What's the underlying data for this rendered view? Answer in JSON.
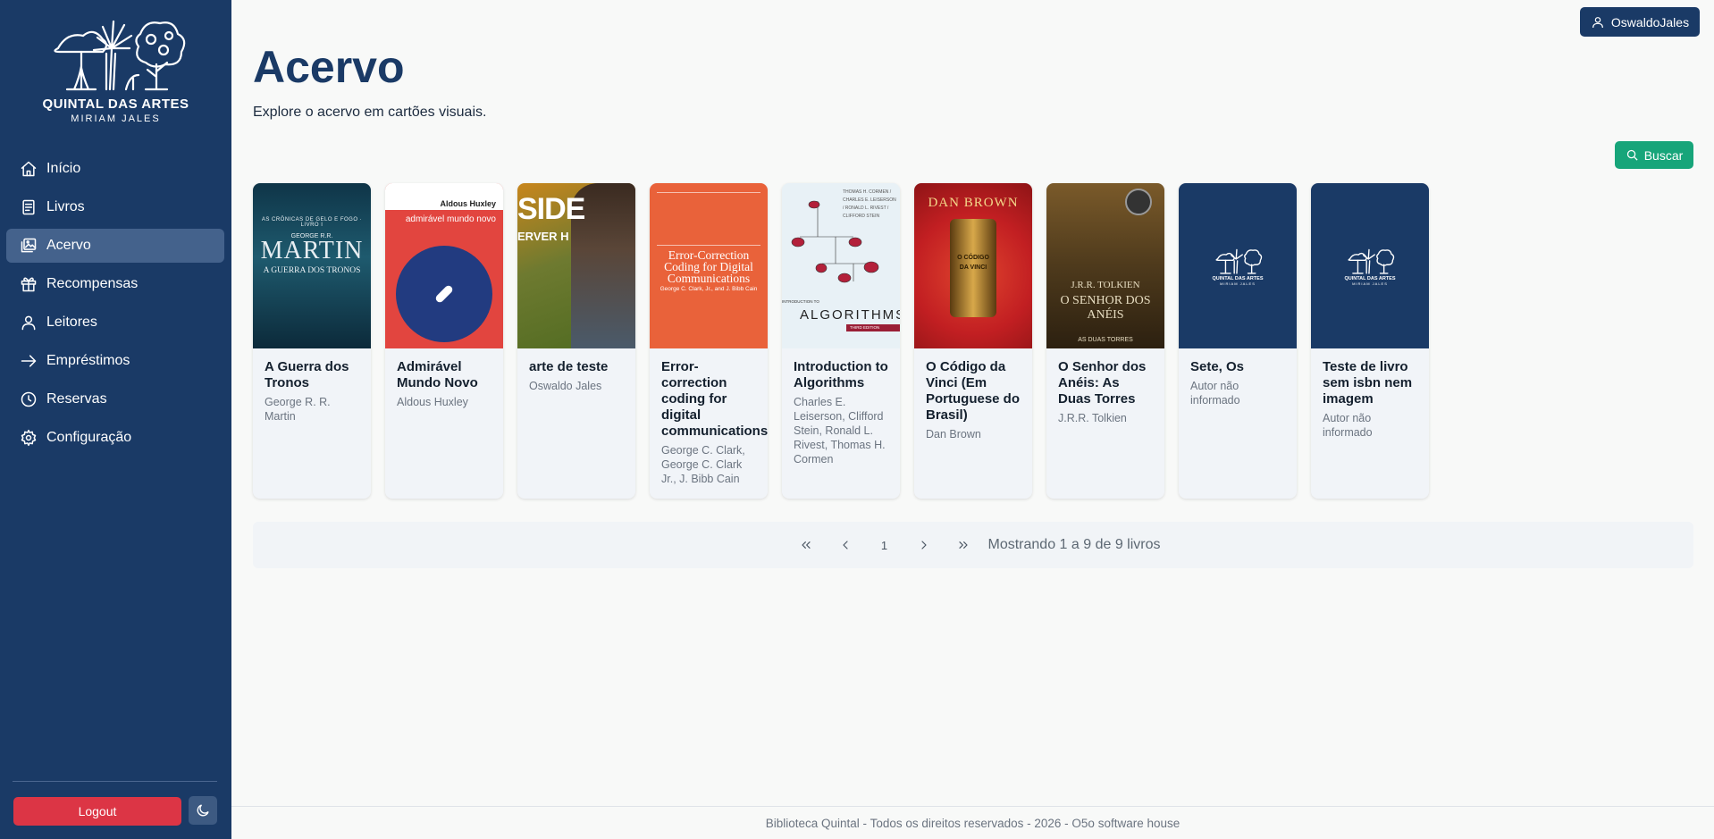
{
  "brand": {
    "title": "QUINTAL DAS ARTES",
    "subtitle": "MIRIAM JALES"
  },
  "sidebar": {
    "items": [
      {
        "label": "Início",
        "icon": "home-icon",
        "active": false
      },
      {
        "label": "Livros",
        "icon": "book-icon",
        "active": false
      },
      {
        "label": "Acervo",
        "icon": "image-gallery-icon",
        "active": true
      },
      {
        "label": "Recompensas",
        "icon": "gift-icon",
        "active": false
      },
      {
        "label": "Leitores",
        "icon": "user-icon",
        "active": false
      },
      {
        "label": "Empréstimos",
        "icon": "arrow-right-icon",
        "active": false
      },
      {
        "label": "Reservas",
        "icon": "clock-icon",
        "active": false
      },
      {
        "label": "Configuração",
        "icon": "gear-icon",
        "active": false
      }
    ],
    "logout_label": "Logout",
    "theme_icon": "moon-icon"
  },
  "header": {
    "user_label": "OswaldoJales"
  },
  "main": {
    "title": "Acervo",
    "subtitle": "Explore o acervo em cartões visuais.",
    "search_label": "Buscar"
  },
  "books": [
    {
      "title": "A Guerra dos Tronos",
      "author": "George R. R. Martin",
      "cover": {
        "small": "AS CRÔNICAS DE GELO E FOGO · LIVRO I",
        "author_line": "GEORGE R.R.",
        "name": "MARTIN",
        "title": "A GUERRA DOS TRONOS"
      }
    },
    {
      "title": "Admirável Mundo Novo",
      "author": "Aldous Huxley",
      "cover": {
        "author_line": "Aldous Huxley",
        "title_line": "admirável mundo novo"
      }
    },
    {
      "title": "arte de teste",
      "author": "Oswaldo Jales",
      "cover": {
        "big": "SIDE",
        "small": "ERVER H"
      }
    },
    {
      "title": "Error-correction coding for digital communications",
      "author": "George C. Clark, George C. Clark Jr., J. Bibb Cain",
      "cover": {
        "title": "Error-Correction Coding for Digital Communications",
        "authors": "George C. Clark, Jr., and J. Bibb Cain"
      }
    },
    {
      "title": "Introduction to Algorithms",
      "author": "Charles E. Leiserson, Clifford Stein, Ronald L. Rivest, Thomas H. Cormen",
      "cover": {
        "authors": "THOMAS H. CORMEN / CHARLES E. LEISERSON / RONALD L. RIVEST / CLIFFORD STEIN",
        "pre": "INTRODUCTION TO",
        "big": "ALGORITHMS",
        "edition": "THIRD EDITION"
      }
    },
    {
      "title": "O Código da Vinci (Em Portuguese do Brasil)",
      "author": "Dan Brown",
      "cover": {
        "author": "DAN BROWN",
        "letters": "O CÓDIGO DA VINCI"
      }
    },
    {
      "title": "O Senhor dos Anéis: As Duas Torres",
      "author": "J.R.R. Tolkien",
      "cover": {
        "author": "J.R.R. TOLKIEN",
        "title": "O SENHOR DOS ANÉIS",
        "sub": "AS DUAS TORRES"
      }
    },
    {
      "title": "Sete, Os",
      "author": "Autor não informado",
      "cover": {
        "logo_title": "QUINTAL DAS ARTES",
        "logo_sub": "MIRIAM JALES"
      }
    },
    {
      "title": "Teste de livro sem isbn nem imagem",
      "author": "Autor não informado",
      "cover": {
        "logo_title": "QUINTAL DAS ARTES",
        "logo_sub": "MIRIAM JALES"
      }
    }
  ],
  "pagination": {
    "current_page": "1",
    "info": "Mostrando 1 a 9 de 9 livros"
  },
  "footer": {
    "text": "Biblioteca Quintal - Todos os direitos reservados - 2026 - O5o software house"
  },
  "colors": {
    "sidebar": "#1a3a66",
    "active": "#44628c",
    "danger": "#dc3545",
    "success": "#17a57a"
  }
}
